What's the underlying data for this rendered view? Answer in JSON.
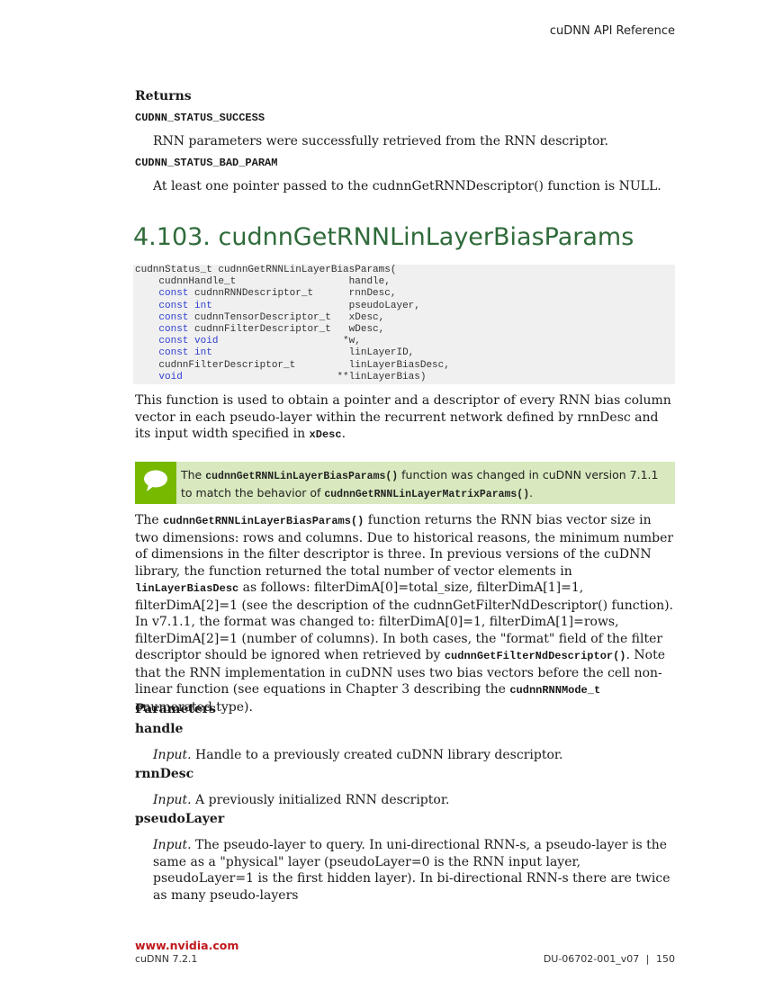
{
  "header": {
    "title": "cuDNN API Reference"
  },
  "returns": {
    "heading": "Returns",
    "items": [
      {
        "code": "CUDNN_STATUS_SUCCESS",
        "desc": "RNN parameters were successfully retrieved from the RNN descriptor."
      },
      {
        "code": "CUDNN_STATUS_BAD_PARAM",
        "desc": "At least one pointer passed to the cudnnGetRNNDescriptor() function is NULL."
      }
    ]
  },
  "section": {
    "number": "4.103.",
    "title": "cudnnGetRNNLinLayerBiasParams"
  },
  "code_block": {
    "lines": [
      "cudnnStatus_t cudnnGetRNNLinLayerBiasParams(",
      "    cudnnHandle_t                   handle,",
      "    const cudnnRNNDescriptor_t      rnnDesc,",
      "    const int                       pseudoLayer,",
      "    const cudnnTensorDescriptor_t   xDesc,",
      "    const cudnnFilterDescriptor_t   wDesc,",
      "    const void                     *w,",
      "    const int                       linLayerID,",
      "    cudnnFilterDescriptor_t         linLayerBiasDesc,",
      "    void                          **linLayerBias)"
    ]
  },
  "intro": {
    "text_before": "This function is used to obtain a pointer and a descriptor of every RNN bias column vector in each pseudo-layer within the recurrent network defined by rnnDesc and its input width specified in ",
    "code": "xDesc",
    "text_after": "."
  },
  "note": {
    "icon": "speech-bubble-icon",
    "text1": "The ",
    "code1": "cudnnGetRNNLinLayerBiasParams()",
    "text2": " function was changed in cuDNN version 7.1.1 to match the behavior of ",
    "code2": "cudnnGetRNNLinLayerMatrixParams()",
    "text3": "."
  },
  "body_paragraph": {
    "t1": "The ",
    "c1": "cudnnGetRNNLinLayerBiasParams()",
    "t2": " function returns the RNN bias vector size in two dimensions: rows and columns. Due to historical reasons, the minimum number of dimensions in the filter descriptor is three. In previous versions of the cuDNN library, the function returned the total number of vector elements in ",
    "c2": "linLayerBiasDesc",
    "t3": " as follows: filterDimA[0]=total_size, filterDimA[1]=1, filterDimA[2]=1 (see the description of the cudnnGetFilterNdDescriptor() function). In v7.1.1, the format was changed to: filterDimA[0]=1, filterDimA[1]=rows, filterDimA[2]=1 (number of columns). In both cases, the \"format\" field of the filter descriptor should be ignored when retrieved by ",
    "c3": "cudnnGetFilterNdDescriptor()",
    "t4": ". Note that the RNN implementation in cuDNN uses two bias vectors before the cell non-linear function (see equations in Chapter 3 describing the ",
    "c4": "cudnnRNNMode_t",
    "t5": " enumerated type)."
  },
  "parameters": {
    "heading": "Parameters",
    "items": [
      {
        "name": "handle",
        "io": "Input.",
        "desc": " Handle to a previously created cuDNN library descriptor."
      },
      {
        "name": "rnnDesc",
        "io": "Input.",
        "desc": " A previously initialized RNN descriptor."
      },
      {
        "name": "pseudoLayer",
        "io": "Input.",
        "desc": " The pseudo-layer to query. In uni-directional RNN-s, a pseudo-layer is the same as a \"physical\" layer (pseudoLayer=0 is the RNN input layer, pseudoLayer=1 is the first hidden layer). In bi-directional RNN-s there are twice as many pseudo-layers"
      }
    ]
  },
  "footer": {
    "url": "www.nvidia.com",
    "product": "cuDNN 7.2.1",
    "doc_id": "DU-06702-001_v07",
    "separator": "|",
    "page": "150"
  },
  "colors": {
    "section_title": "#2f6b3a",
    "note_bg": "#d9e9bf",
    "note_icon_bg": "#76b900",
    "footer_url": "#c0181d",
    "keyword": "#2f3fd0"
  }
}
